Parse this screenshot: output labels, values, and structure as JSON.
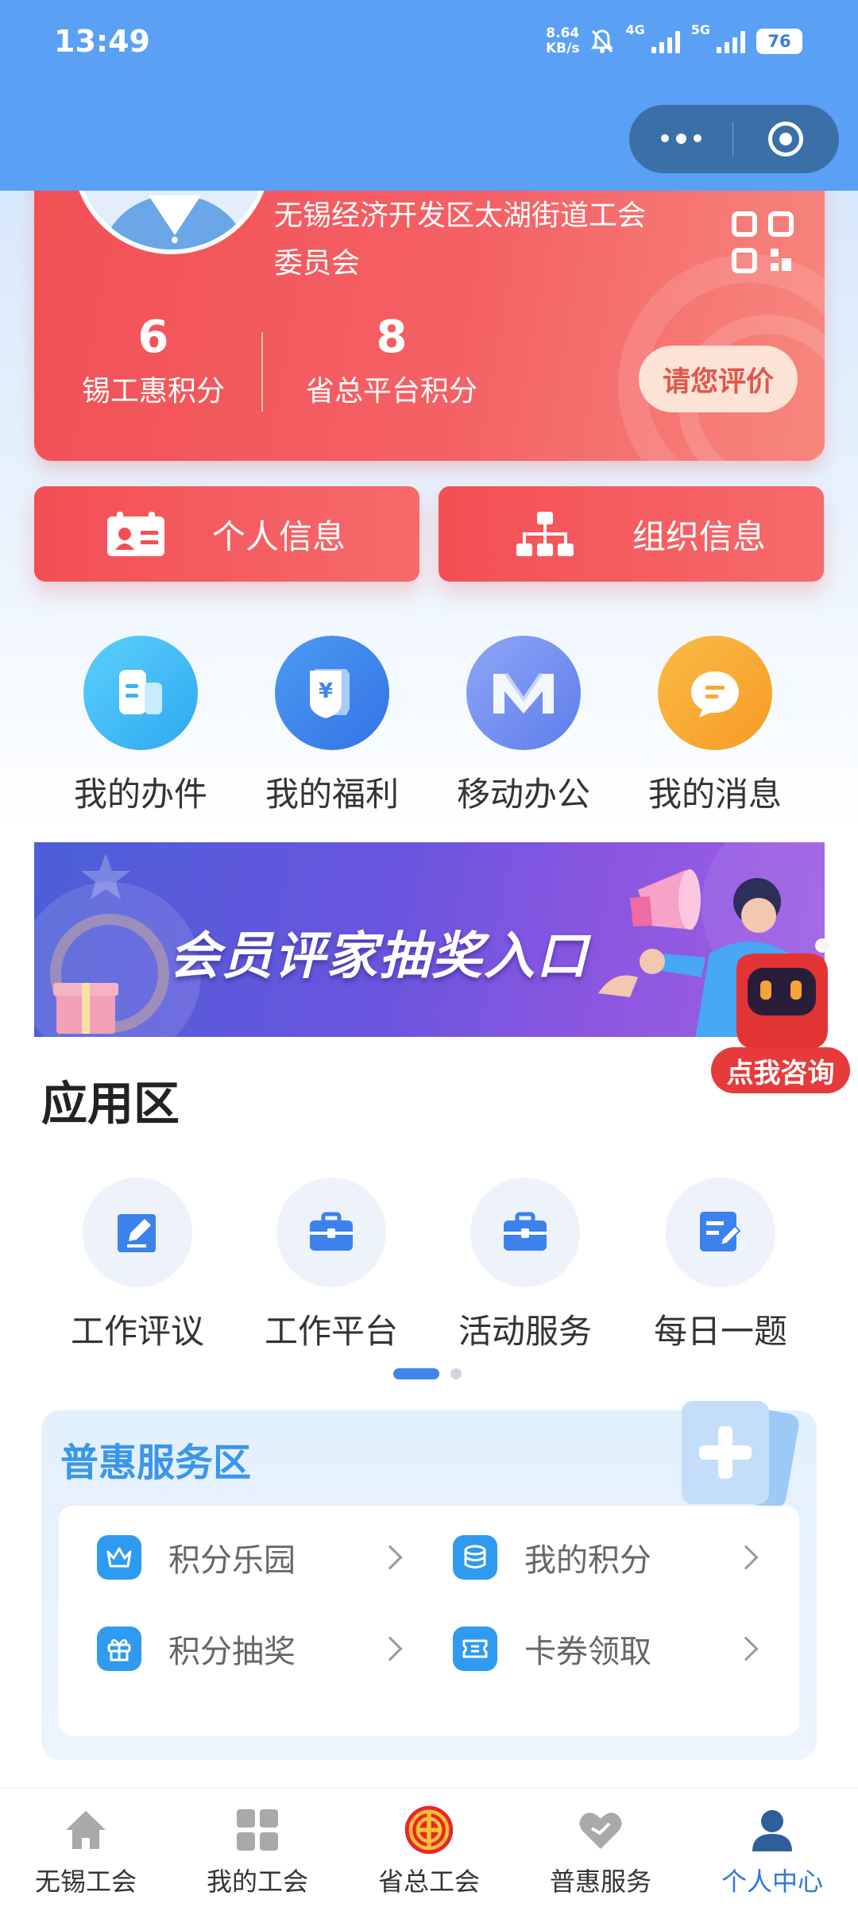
{
  "status_bar": {
    "time": "13:49",
    "net_speed_value": "8.64",
    "net_speed_unit": "KB/s",
    "sim1": "4G",
    "sim2": "5G",
    "battery": "76"
  },
  "profile": {
    "org_name": "无锡经济开发区太湖街道工会委员会",
    "points": [
      {
        "value": "6",
        "label": "锡工惠积分"
      },
      {
        "value": "8",
        "label": "省总平台积分"
      }
    ],
    "rate_button": "请您评价"
  },
  "info_buttons": {
    "personal": "个人信息",
    "organization": "组织信息"
  },
  "quick_actions": [
    {
      "label": "我的办件",
      "icon": "document-icon",
      "color": "#3fb5f2"
    },
    {
      "label": "我的福利",
      "icon": "yuan-shield-icon",
      "color": "#3d84ef"
    },
    {
      "label": "移动办公",
      "icon": "m-logo-icon",
      "color": "#6f8cf0"
    },
    {
      "label": "我的消息",
      "icon": "chat-bubble-icon",
      "color": "#f8a732"
    }
  ],
  "banner": {
    "text": "会员评家抽奖入口"
  },
  "assistant": {
    "label": "点我咨询"
  },
  "app_section": {
    "title": "应用区",
    "items": [
      {
        "label": "工作评议",
        "icon": "edit-icon"
      },
      {
        "label": "工作平台",
        "icon": "briefcase-icon"
      },
      {
        "label": "活动服务",
        "icon": "briefcase-icon"
      },
      {
        "label": "每日一题",
        "icon": "checklist-icon"
      }
    ]
  },
  "benefits": {
    "title": "普惠服务区",
    "items": [
      {
        "label": "积分乐园",
        "icon": "crown-icon"
      },
      {
        "label": "我的积分",
        "icon": "database-icon"
      },
      {
        "label": "积分抽奖",
        "icon": "gift-icon"
      },
      {
        "label": "卡券领取",
        "icon": "ticket-icon"
      }
    ]
  },
  "tabbar": {
    "items": [
      {
        "label": "无锡工会",
        "icon": "home-icon"
      },
      {
        "label": "我的工会",
        "icon": "grid-icon"
      },
      {
        "label": "省总工会",
        "icon": "union-emblem-icon"
      },
      {
        "label": "普惠服务",
        "icon": "heart-icon"
      },
      {
        "label": "个人中心",
        "icon": "user-icon"
      }
    ],
    "active_index": 4
  },
  "colors": {
    "header": "#5aa0f5",
    "card_red": "#f25055",
    "accent_blue": "#3178d8"
  }
}
